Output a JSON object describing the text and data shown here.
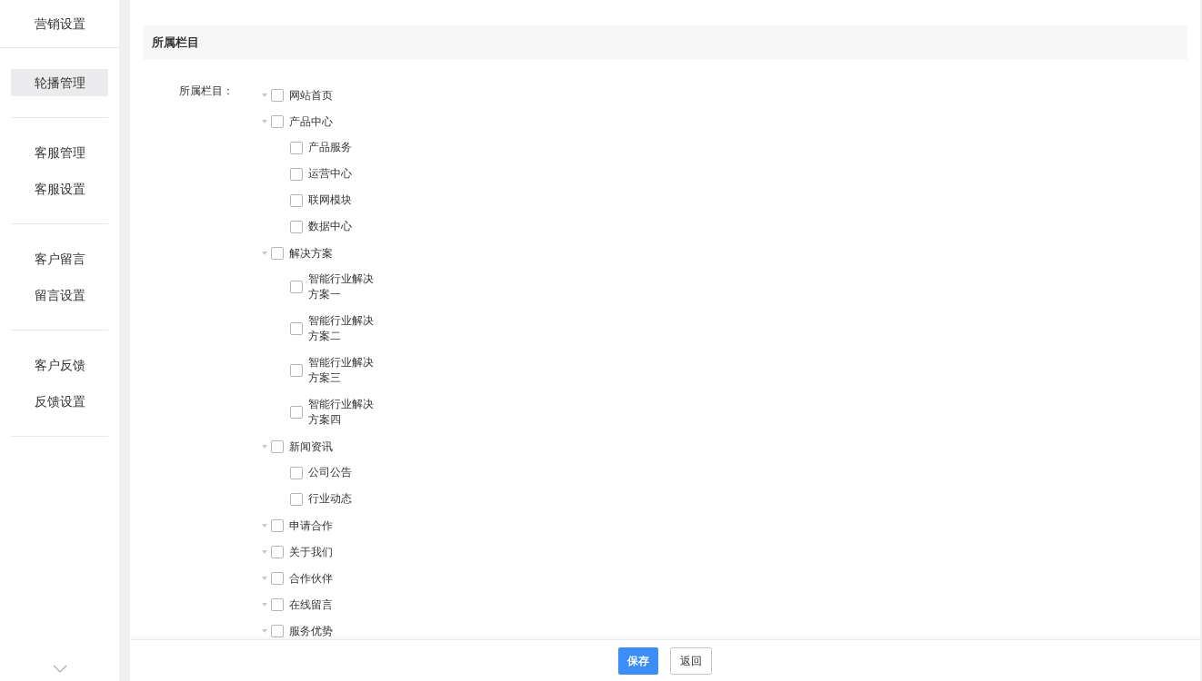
{
  "sidebar": {
    "title": "营销设置",
    "groups": [
      [
        {
          "label": "轮播管理",
          "selected": true
        }
      ],
      [
        {
          "label": "客服管理",
          "selected": false
        },
        {
          "label": "客服设置",
          "selected": false
        }
      ],
      [
        {
          "label": "客户留言",
          "selected": false
        },
        {
          "label": "留言设置",
          "selected": false
        }
      ],
      [
        {
          "label": "客户反馈",
          "selected": false
        },
        {
          "label": "反馈设置",
          "selected": false
        }
      ]
    ]
  },
  "section": {
    "title": "所属栏目"
  },
  "field": {
    "label": "所属栏目：",
    "tree": [
      {
        "label": "网站首页",
        "checked": false,
        "expanded": true
      },
      {
        "label": "产品中心",
        "checked": false,
        "expanded": true,
        "children": [
          {
            "label": "产品服务",
            "checked": false
          },
          {
            "label": "运营中心",
            "checked": false
          },
          {
            "label": "联网模块",
            "checked": false
          },
          {
            "label": "数据中心",
            "checked": false
          }
        ]
      },
      {
        "label": "解决方案",
        "checked": false,
        "expanded": true,
        "children": [
          {
            "label": "智能行业解决方案一",
            "checked": false
          },
          {
            "label": "智能行业解决方案二",
            "checked": false
          },
          {
            "label": "智能行业解决方案三",
            "checked": false
          },
          {
            "label": "智能行业解决方案四",
            "checked": false
          }
        ]
      },
      {
        "label": "新闻资讯",
        "checked": false,
        "expanded": true,
        "children": [
          {
            "label": "公司公告",
            "checked": false
          },
          {
            "label": "行业动态",
            "checked": false
          }
        ]
      },
      {
        "label": "申请合作",
        "checked": false,
        "expanded": true
      },
      {
        "label": "关于我们",
        "checked": false,
        "expanded": true
      },
      {
        "label": "合作伙伴",
        "checked": false,
        "expanded": true
      },
      {
        "label": "在线留言",
        "checked": false,
        "expanded": true
      },
      {
        "label": "服务优势",
        "checked": false,
        "expanded": true
      }
    ]
  },
  "footer": {
    "buttons": [
      {
        "label": "保存",
        "kind": "primary"
      },
      {
        "label": "返回",
        "kind": "default"
      }
    ]
  }
}
